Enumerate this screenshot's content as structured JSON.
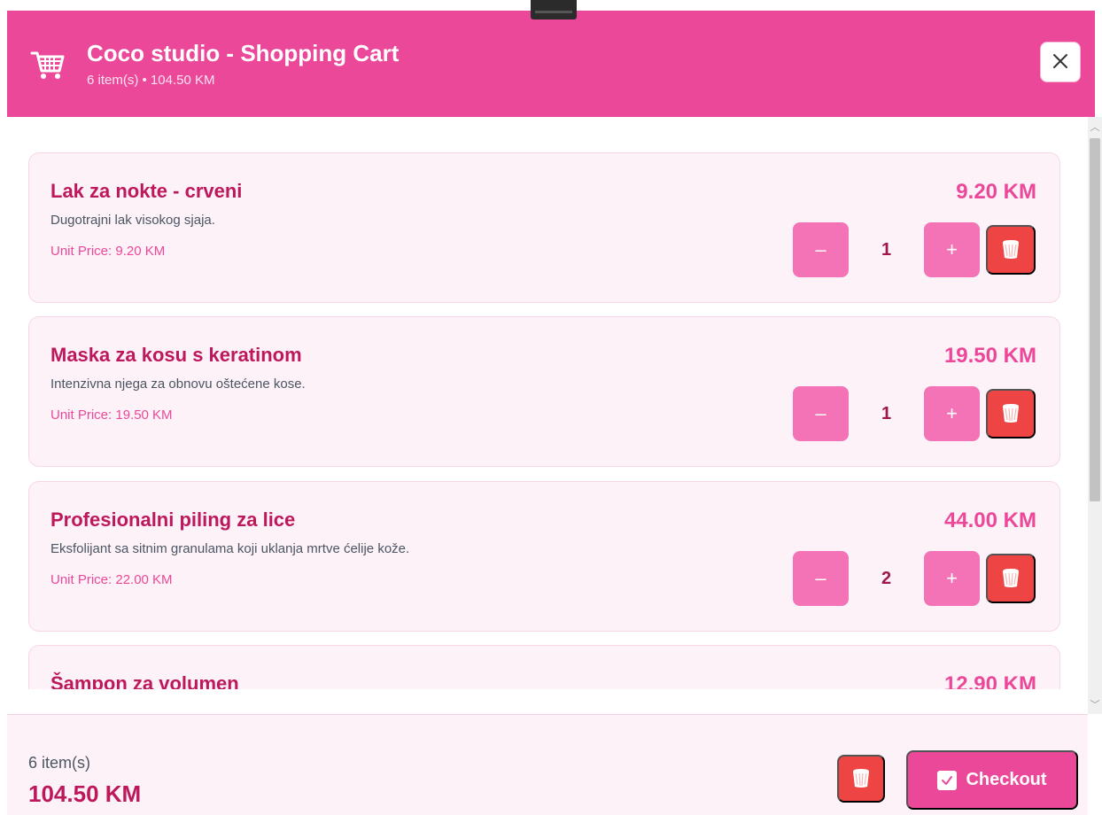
{
  "header": {
    "title": "Coco studio - Shopping Cart",
    "subtitle": "6 item(s) • 104.50 KM",
    "close_label": "×",
    "icons": {
      "cart": "shopping-cart-icon",
      "close": "close-icon"
    }
  },
  "items": [
    {
      "name": "Lak za nokte - crveni",
      "description": "Dugotrajni lak visokog sjaja.",
      "unit_price": "Unit Price: 9.20 KM",
      "total": "9.20 KM",
      "quantity": "1",
      "minus_label": "–",
      "plus_label": "+"
    },
    {
      "name": "Maska za kosu s keratinom",
      "description": "Intenzivna njega za obnovu oštećene kose.",
      "unit_price": "Unit Price: 19.50 KM",
      "total": "19.50 KM",
      "quantity": "1",
      "minus_label": "–",
      "plus_label": "+"
    },
    {
      "name": "Profesionalni piling za lice",
      "description": "Eksfolijant sa sitnim granulama koji uklanja mrtve ćelije kože.",
      "unit_price": "Unit Price: 22.00 KM",
      "total": "44.00 KM",
      "quantity": "2",
      "minus_label": "–",
      "plus_label": "+"
    },
    {
      "name": "Šampon za volumen",
      "total": "12.90 KM"
    }
  ],
  "footer": {
    "count": "6 item(s)",
    "total": "104.50 KM",
    "checkout_label": "Checkout",
    "icons": {
      "clear": "trash-icon",
      "checkout": "checkbox-check-icon"
    }
  },
  "colors": {
    "primary": "#ec4899",
    "item_title": "#be185d",
    "card_background": "#fdf2f7",
    "quantity_button": "#f472b6",
    "danger": "#ef4444"
  }
}
